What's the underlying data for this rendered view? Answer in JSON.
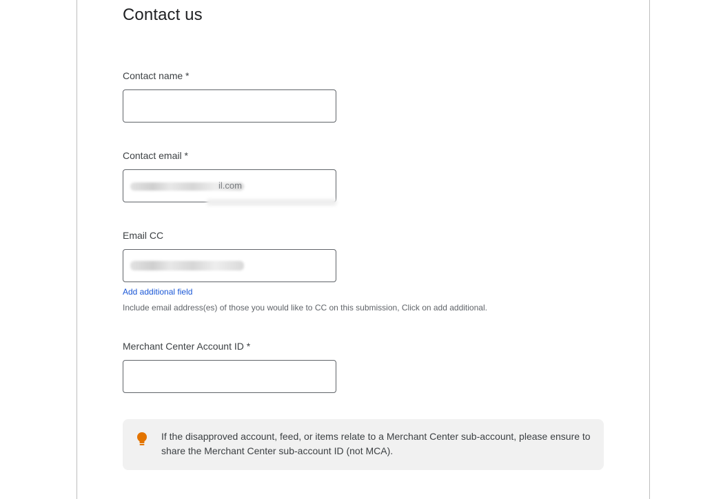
{
  "form": {
    "title": "Contact us",
    "contact_name": {
      "label": "Contact name *",
      "value": ""
    },
    "contact_email": {
      "label": "Contact email *",
      "visible_suffix": "il.com"
    },
    "email_cc": {
      "label": "Email CC"
    },
    "add_field_link": "Add additional field",
    "cc_help": "Include email address(es) of those you would like to CC on this submission, Click on add additional.",
    "merchant_id": {
      "label": "Merchant Center Account ID *",
      "value": ""
    },
    "notice": {
      "icon": "lightbulb-icon",
      "icon_color": "#e37400",
      "text": "If the disapproved account, feed, or items relate to a Merchant Center sub-account, please ensure to share the Merchant Center sub-account ID (not MCA)."
    }
  },
  "colors": {
    "link": "#1a57d6",
    "notice_background": "#f1f1f1",
    "field_border": "#5f6368"
  }
}
